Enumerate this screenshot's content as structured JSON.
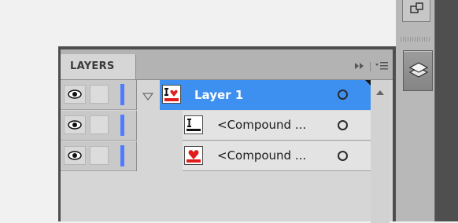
{
  "panel": {
    "tab_label": "LAYERS",
    "controls": {
      "collapse_icon": "double-arrow-right-icon",
      "menu_icon": "panel-menu-icon"
    },
    "accent_color": "#3d90f0",
    "layer_color": "#4f7cff"
  },
  "layers": [
    {
      "name": "Layer 1",
      "selected": true,
      "expanded": true,
      "visible": true
    }
  ],
  "sublayers": [
    {
      "name": "<Compound ...",
      "visible": true
    },
    {
      "name": "<Compound ...",
      "visible": true
    }
  ],
  "dock": {
    "top_button_icon": "arrange-windows-icon",
    "layers_button_icon": "layers-stack-icon"
  }
}
